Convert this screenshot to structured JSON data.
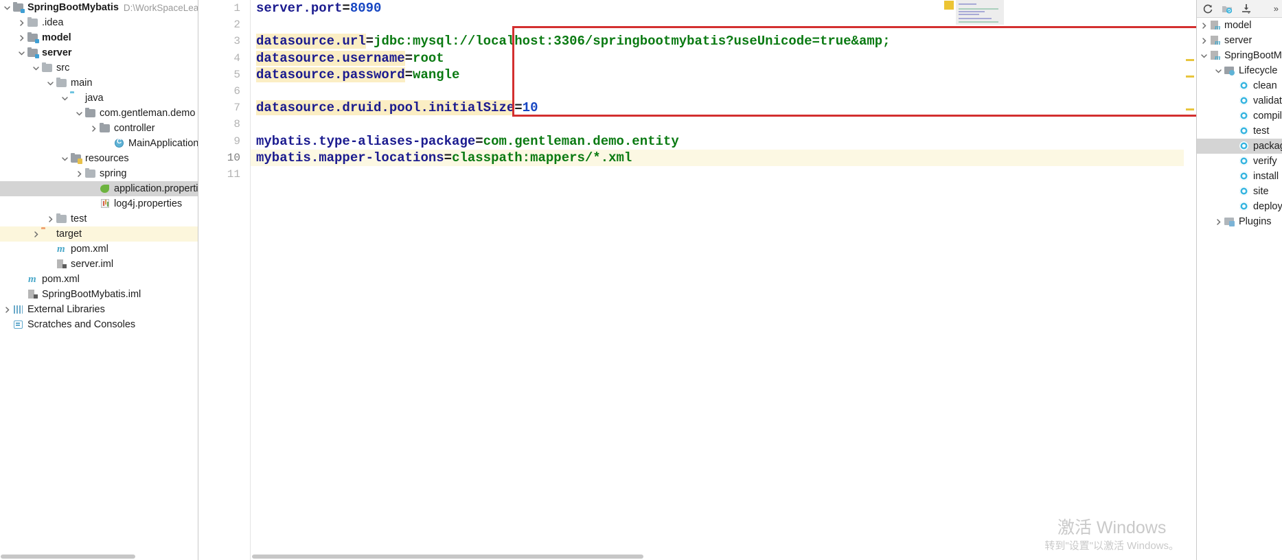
{
  "project_tree": {
    "items": [
      {
        "label": "SpringBootMybatis",
        "note": "D:\\WorkSpaceLearn",
        "depth": 0,
        "arrow": "down",
        "icon": "module-folder-icon",
        "bold": true,
        "state": "normal"
      },
      {
        "label": ".idea",
        "note": "",
        "depth": 1,
        "arrow": "right",
        "icon": "folder-icon",
        "bold": false,
        "state": "normal"
      },
      {
        "label": "model",
        "note": "",
        "depth": 1,
        "arrow": "right",
        "icon": "module-folder-icon",
        "bold": true,
        "state": "normal"
      },
      {
        "label": "server",
        "note": "",
        "depth": 1,
        "arrow": "down",
        "icon": "module-folder-icon",
        "bold": true,
        "state": "normal"
      },
      {
        "label": "src",
        "note": "",
        "depth": 2,
        "arrow": "down",
        "icon": "folder-icon",
        "bold": false,
        "state": "normal"
      },
      {
        "label": "main",
        "note": "",
        "depth": 3,
        "arrow": "down",
        "icon": "folder-icon",
        "bold": false,
        "state": "normal"
      },
      {
        "label": "java",
        "note": "",
        "depth": 4,
        "arrow": "down",
        "icon": "source-folder-icon",
        "bold": false,
        "state": "normal"
      },
      {
        "label": "com.gentleman.demo",
        "note": "",
        "depth": 5,
        "arrow": "down",
        "icon": "package-icon",
        "bold": false,
        "state": "normal"
      },
      {
        "label": "controller",
        "note": "",
        "depth": 6,
        "arrow": "right",
        "icon": "package-icon",
        "bold": false,
        "state": "normal"
      },
      {
        "label": "MainApplication",
        "note": "",
        "depth": 7,
        "arrow": "none",
        "icon": "java-class-icon",
        "bold": false,
        "state": "normal"
      },
      {
        "label": "resources",
        "note": "",
        "depth": 4,
        "arrow": "down",
        "icon": "resources-folder-icon",
        "bold": false,
        "state": "normal"
      },
      {
        "label": "spring",
        "note": "",
        "depth": 5,
        "arrow": "right",
        "icon": "folder-icon",
        "bold": false,
        "state": "normal"
      },
      {
        "label": "application.properties",
        "note": "",
        "depth": 6,
        "arrow": "none",
        "icon": "spring-properties-icon",
        "bold": false,
        "state": "selected"
      },
      {
        "label": "log4j.properties",
        "note": "",
        "depth": 6,
        "arrow": "none",
        "icon": "properties-icon",
        "bold": false,
        "state": "normal"
      },
      {
        "label": "test",
        "note": "",
        "depth": 3,
        "arrow": "right",
        "icon": "folder-icon",
        "bold": false,
        "state": "normal"
      },
      {
        "label": "target",
        "note": "",
        "depth": 2,
        "arrow": "right",
        "icon": "target-folder-icon",
        "bold": false,
        "state": "highlight"
      },
      {
        "label": "pom.xml",
        "note": "",
        "depth": 3,
        "arrow": "none",
        "icon": "maven-pom-icon",
        "bold": false,
        "state": "normal"
      },
      {
        "label": "server.iml",
        "note": "",
        "depth": 3,
        "arrow": "none",
        "icon": "iml-icon",
        "bold": false,
        "state": "normal"
      },
      {
        "label": "pom.xml",
        "note": "",
        "depth": 1,
        "arrow": "none",
        "icon": "maven-pom-icon",
        "bold": false,
        "state": "normal"
      },
      {
        "label": "SpringBootMybatis.iml",
        "note": "",
        "depth": 1,
        "arrow": "none",
        "icon": "iml-icon",
        "bold": false,
        "state": "normal"
      },
      {
        "label": "External Libraries",
        "note": "",
        "depth": 0,
        "arrow": "right",
        "icon": "external-libraries-icon",
        "bold": false,
        "state": "normal"
      },
      {
        "label": "Scratches and Consoles",
        "note": "",
        "depth": 0,
        "arrow": "none",
        "icon": "scratches-icon",
        "bold": false,
        "state": "normal"
      }
    ]
  },
  "editor": {
    "file": "application.properties",
    "current_line": 10,
    "gutter_numbers": [
      "1",
      "2",
      "3",
      "4",
      "5",
      "6",
      "7",
      "8",
      "9",
      "10",
      "11"
    ],
    "lines": [
      {
        "n": 1,
        "key": "server.port",
        "eq": "=",
        "value": "8090",
        "value_kind": "number",
        "key_highlight": false,
        "current": false
      },
      {
        "n": 2,
        "key": "",
        "eq": "",
        "value": "",
        "value_kind": "none",
        "key_highlight": false,
        "current": false
      },
      {
        "n": 3,
        "key": "datasource.url",
        "eq": "=",
        "value": "jdbc:mysql://localhost:3306/springbootmybatis?useUnicode=true&amp;",
        "value_kind": "string",
        "key_highlight": true,
        "current": false
      },
      {
        "n": 4,
        "key": "datasource.username",
        "eq": "=",
        "value": "root",
        "value_kind": "string",
        "key_highlight": true,
        "current": false
      },
      {
        "n": 5,
        "key": "datasource.password",
        "eq": "=",
        "value": "wangle",
        "value_kind": "string",
        "key_highlight": true,
        "current": false
      },
      {
        "n": 6,
        "key": "",
        "eq": "",
        "value": "",
        "value_kind": "none",
        "key_highlight": false,
        "current": false
      },
      {
        "n": 7,
        "key": "datasource.druid.pool.initialSize",
        "eq": "=",
        "value": "10",
        "value_kind": "number",
        "key_highlight": true,
        "current": false
      },
      {
        "n": 8,
        "key": "",
        "eq": "",
        "value": "",
        "value_kind": "none",
        "key_highlight": false,
        "current": false
      },
      {
        "n": 9,
        "key": "mybatis.type-aliases-package",
        "eq": "=",
        "value": "com.gentleman.demo.entity",
        "value_kind": "string",
        "key_highlight": false,
        "current": false
      },
      {
        "n": 10,
        "key": "mybatis.mapper-locations",
        "eq": "=",
        "value": "classpath:mappers/*.xml",
        "value_kind": "string",
        "key_highlight": false,
        "current": true
      },
      {
        "n": 11,
        "key": "",
        "eq": "",
        "value": "",
        "value_kind": "none",
        "key_highlight": false,
        "current": false
      }
    ],
    "annotation": {
      "shape": "rectangle",
      "color": "#d32f2f",
      "covers_lines": "3-7"
    },
    "colors": {
      "key": "#1b1b8f",
      "value_string": "#0a7a12",
      "value_number": "#1746c2",
      "key_highlight_bg": "#fbeec4",
      "current_line_bg": "#fcf8e3"
    }
  },
  "maven_panel": {
    "toolbar": [
      {
        "name": "refresh-icon",
        "glyph": "reload"
      },
      {
        "name": "add-maven-project-icon",
        "glyph": "folder-sync"
      },
      {
        "name": "download-sources-icon",
        "glyph": "download"
      },
      {
        "name": "more-options-icon",
        "glyph": "chevrons"
      }
    ],
    "tree": [
      {
        "label": "model",
        "depth": 0,
        "arrow": "right",
        "icon": "maven-module-icon",
        "state": "normal"
      },
      {
        "label": "server",
        "depth": 0,
        "arrow": "right",
        "icon": "maven-module-icon",
        "state": "normal"
      },
      {
        "label": "SpringBootMybatis",
        "depth": 0,
        "arrow": "down",
        "icon": "maven-module-icon",
        "state": "normal"
      },
      {
        "label": "Lifecycle",
        "depth": 1,
        "arrow": "down",
        "icon": "lifecycle-folder-icon",
        "state": "normal"
      },
      {
        "label": "clean",
        "depth": 2,
        "arrow": "none",
        "icon": "maven-goal-icon",
        "state": "normal"
      },
      {
        "label": "validate",
        "depth": 2,
        "arrow": "none",
        "icon": "maven-goal-icon",
        "state": "normal"
      },
      {
        "label": "compile",
        "depth": 2,
        "arrow": "none",
        "icon": "maven-goal-icon",
        "state": "normal"
      },
      {
        "label": "test",
        "depth": 2,
        "arrow": "none",
        "icon": "maven-goal-icon",
        "state": "normal"
      },
      {
        "label": "package",
        "depth": 2,
        "arrow": "none",
        "icon": "maven-goal-icon",
        "state": "selected"
      },
      {
        "label": "verify",
        "depth": 2,
        "arrow": "none",
        "icon": "maven-goal-icon",
        "state": "normal"
      },
      {
        "label": "install",
        "depth": 2,
        "arrow": "none",
        "icon": "maven-goal-icon",
        "state": "normal"
      },
      {
        "label": "site",
        "depth": 2,
        "arrow": "none",
        "icon": "maven-goal-icon",
        "state": "normal"
      },
      {
        "label": "deploy",
        "depth": 2,
        "arrow": "none",
        "icon": "maven-goal-icon",
        "state": "normal"
      },
      {
        "label": "Plugins",
        "depth": 1,
        "arrow": "right",
        "icon": "plugins-folder-icon",
        "state": "normal"
      }
    ]
  },
  "watermark": {
    "title": "激活 Windows",
    "subtitle": "转到\"设置\"以激活 Windows。"
  }
}
